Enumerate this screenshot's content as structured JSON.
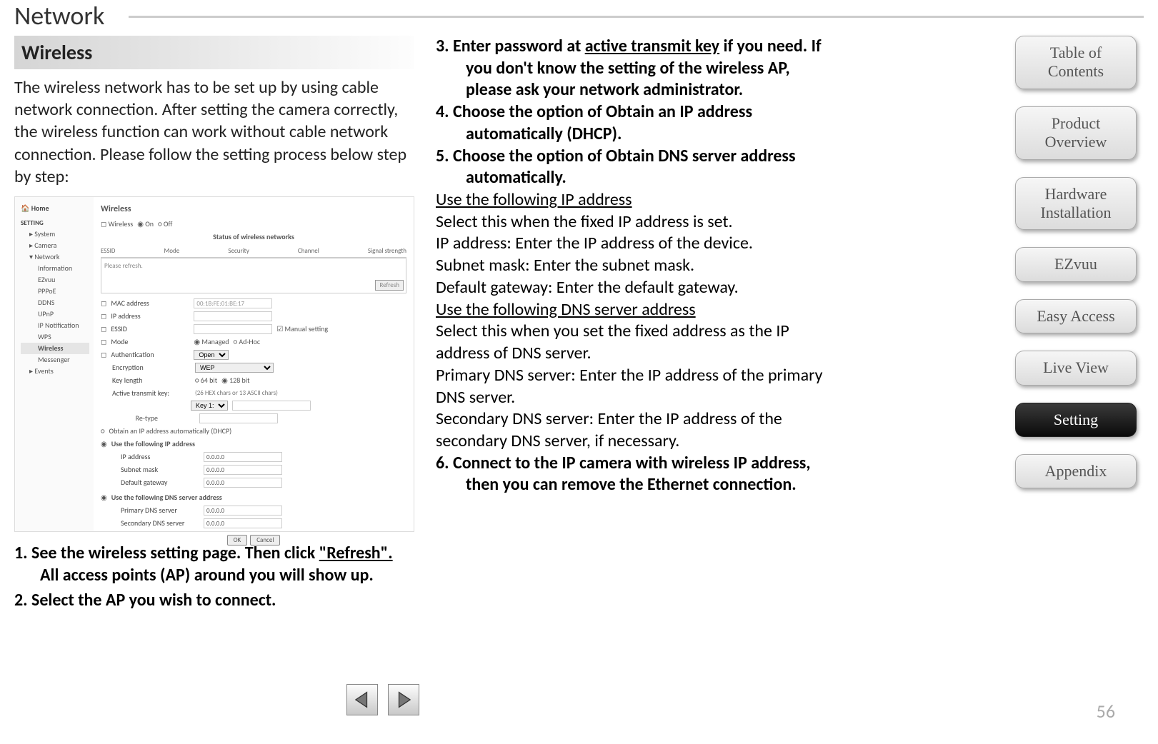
{
  "page": {
    "section_title": "Network",
    "page_number": "56"
  },
  "left": {
    "heading": "Wireless",
    "intro": "The wireless network has to be set up by using cable network connection. After setting the camera correctly, the wireless function can work without cable network connection. Please follow the setting process below step by step:",
    "steps": {
      "s1_pre": "1.   See the wireless setting page. Then click ",
      "s1_u": "\"Refresh\".",
      "s1_post": " All access points (AP) around you will show up.",
      "s2": "2.   Select the AP you wish to connect."
    }
  },
  "screenshot": {
    "nav": {
      "home": "Home",
      "cat_setting": "SETTING",
      "items_top": [
        "System",
        "Camera",
        "Network"
      ],
      "items_net": [
        "Information",
        "EZvuu",
        "PPPoE",
        "DDNS",
        "UPnP",
        "IP Notification",
        "WPS",
        "Wireless",
        "Messenger"
      ],
      "items_bottom": [
        "Events"
      ]
    },
    "main": {
      "title": "Wireless",
      "radio_label": "Wireless",
      "radio_on": "On",
      "radio_off": "Off",
      "table_caption": "Status of wireless networks",
      "cols": [
        "ESSID",
        "Mode",
        "Security",
        "Channel",
        "Signal strength"
      ],
      "table_placeholder": "Please refresh.",
      "refresh_btn": "Refresh",
      "fields": {
        "mac_label": "MAC address",
        "mac_value": "00:1B:FE:01:BE:17",
        "ip_label": "IP address",
        "essid_label": "ESSID",
        "manual": "Manual setting",
        "mode_label": "Mode",
        "mode_managed": "Managed",
        "mode_adhoc": "Ad-Hoc",
        "auth_label": "Authentication",
        "auth_value": "Open",
        "enc_label": "Encryption",
        "enc_value": "WEP",
        "keylen_label": "Key length",
        "keylen_64": "64 bit",
        "keylen_128": "128 bit",
        "atk_label": "Active transmit key:",
        "atk_hint": "(26 HEX chars or 13 ASCII chars)",
        "key1": "Key 1:",
        "retype": "Re-type",
        "dhcp": "Obtain an IP address automatically (DHCP)",
        "use_ip": "Use the following IP address",
        "ipaddr_label": "IP address",
        "ipaddr_value": "0.0.0.0",
        "subnet_label": "Subnet mask",
        "subnet_value": "0.0.0.0",
        "gw_label": "Default gateway",
        "gw_value": "0.0.0.0",
        "use_dns": "Use the following DNS server address",
        "pdns_label": "Primary DNS server",
        "pdns_value": "0.0.0.0",
        "sdns_label": "Secondary DNS server",
        "sdns_value": "0.0.0.0",
        "ok": "OK",
        "cancel": "Cancel"
      }
    }
  },
  "right": {
    "s3_pre": "3.   Enter password at ",
    "s3_u": "active transmit key",
    "s3_post": " if you need. If you don't know the setting of the wireless AP, please ask your network administrator.",
    "s4": "4.   Choose the option of Obtain an IP address automatically (DHCP).",
    "s5": "5.   Choose the option of Obtain DNS server address automatically.",
    "use_ip_hdr": "Use the following IP address",
    "use_ip_desc": "Select this when the fixed IP address is set.",
    "ip_desc": "IP address: Enter the IP address of the device.",
    "subnet_desc": "Subnet mask: Enter the subnet mask.",
    "gw_desc": "Default gateway: Enter the default gateway.",
    "use_dns_hdr": "Use the following DNS server address",
    "use_dns_desc": "Select this when you set the fixed address as the IP address of DNS server.",
    "pdns_desc": "Primary DNS server: Enter the IP address of the primary DNS server.",
    "sdns_desc": "Secondary DNS server: Enter the IP address of the secondary DNS server, if necessary.",
    "s6": "6.   Connect to the IP camera with wireless IP address, then you can remove the Ethernet connection."
  },
  "sidenav": {
    "toc": "Table of Contents",
    "product": "Product Overview",
    "hardware": "Hardware Installation",
    "ezvuu": "EZvuu",
    "easy": "Easy Access",
    "live": "Live View",
    "setting": "Setting",
    "appendix": "Appendix"
  }
}
